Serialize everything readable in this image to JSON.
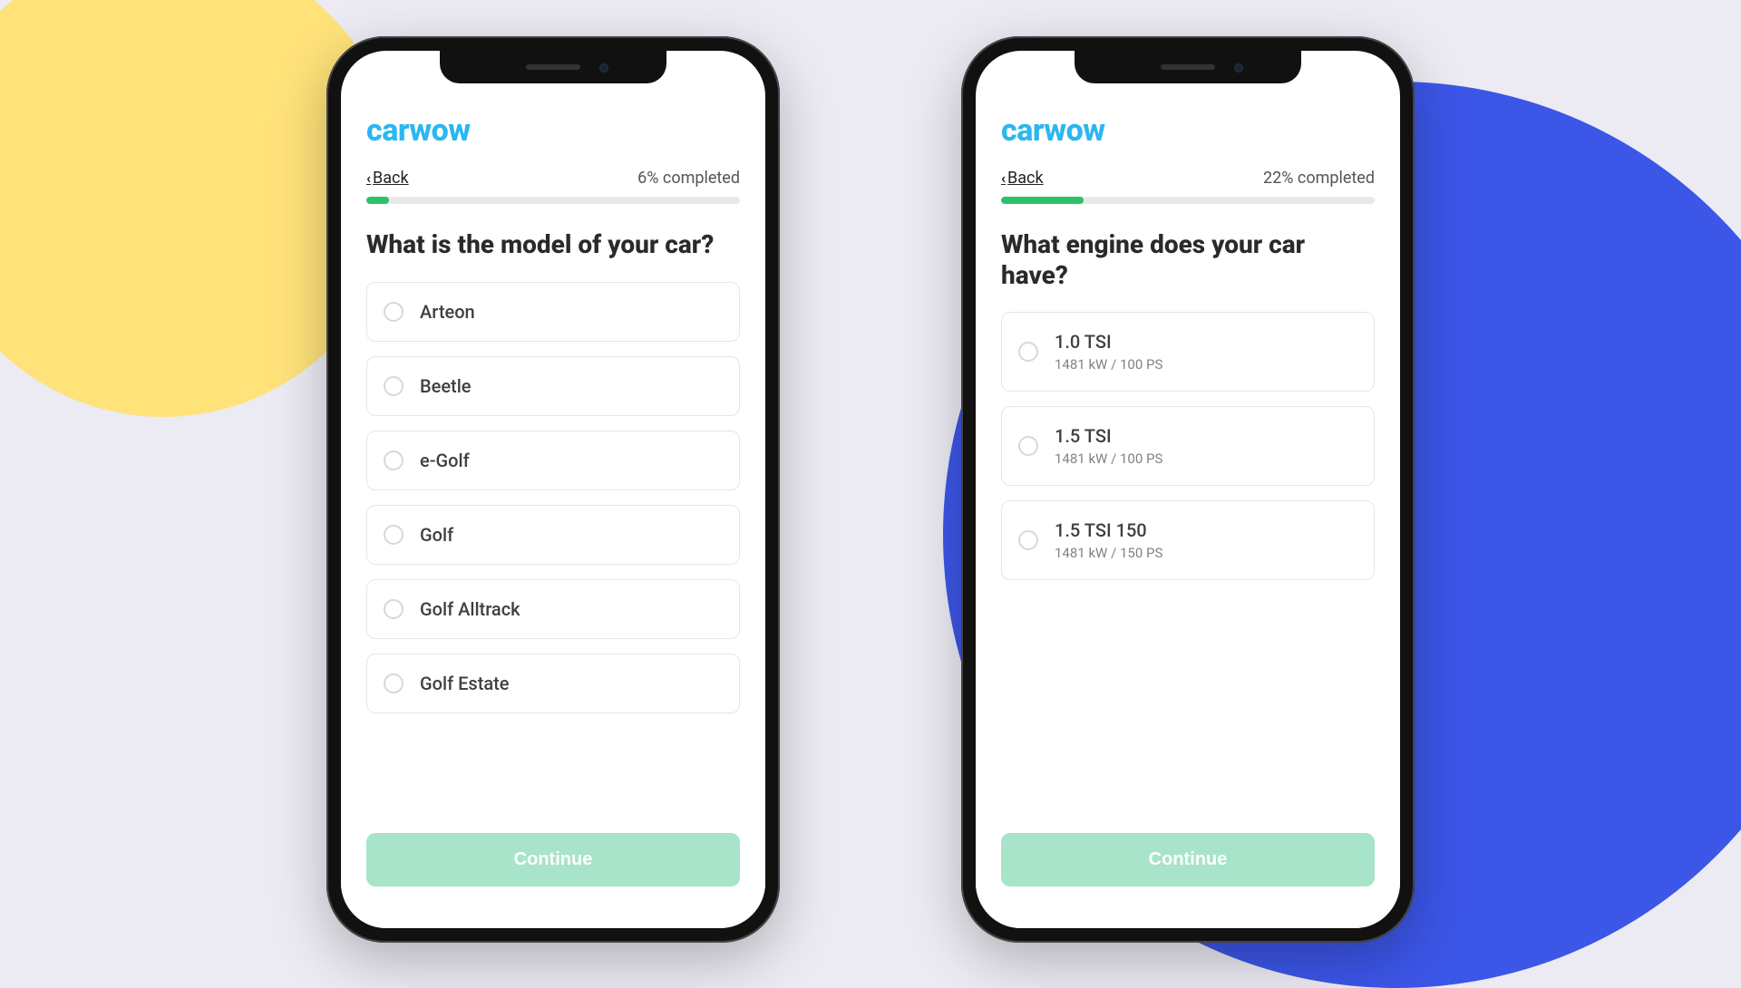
{
  "colors": {
    "brand": "#2bb7f0",
    "progress": "#2ec16a",
    "cta_disabled": "#a7e4c9",
    "bg_yellow": "#ffe27a",
    "bg_blue": "#3c56e8"
  },
  "screens": [
    {
      "brand": "carwow",
      "back_label": "Back",
      "progress_pct": 6,
      "completed_text": "6% completed",
      "question": "What is the model of your car?",
      "options": [
        {
          "label": "Arteon"
        },
        {
          "label": "Beetle"
        },
        {
          "label": "e-Golf"
        },
        {
          "label": "Golf"
        },
        {
          "label": "Golf Alltrack"
        },
        {
          "label": "Golf Estate"
        }
      ],
      "cta": "Continue"
    },
    {
      "brand": "carwow",
      "back_label": "Back",
      "progress_pct": 22,
      "completed_text": "22% completed",
      "question": "What engine does your car have?",
      "options": [
        {
          "label": "1.0 TSI",
          "sub": "1481 kW / 100 PS"
        },
        {
          "label": "1.5 TSI",
          "sub": "1481 kW / 100 PS"
        },
        {
          "label": "1.5 TSI 150",
          "sub": "1481 kW / 150 PS"
        }
      ],
      "cta": "Continue"
    }
  ]
}
